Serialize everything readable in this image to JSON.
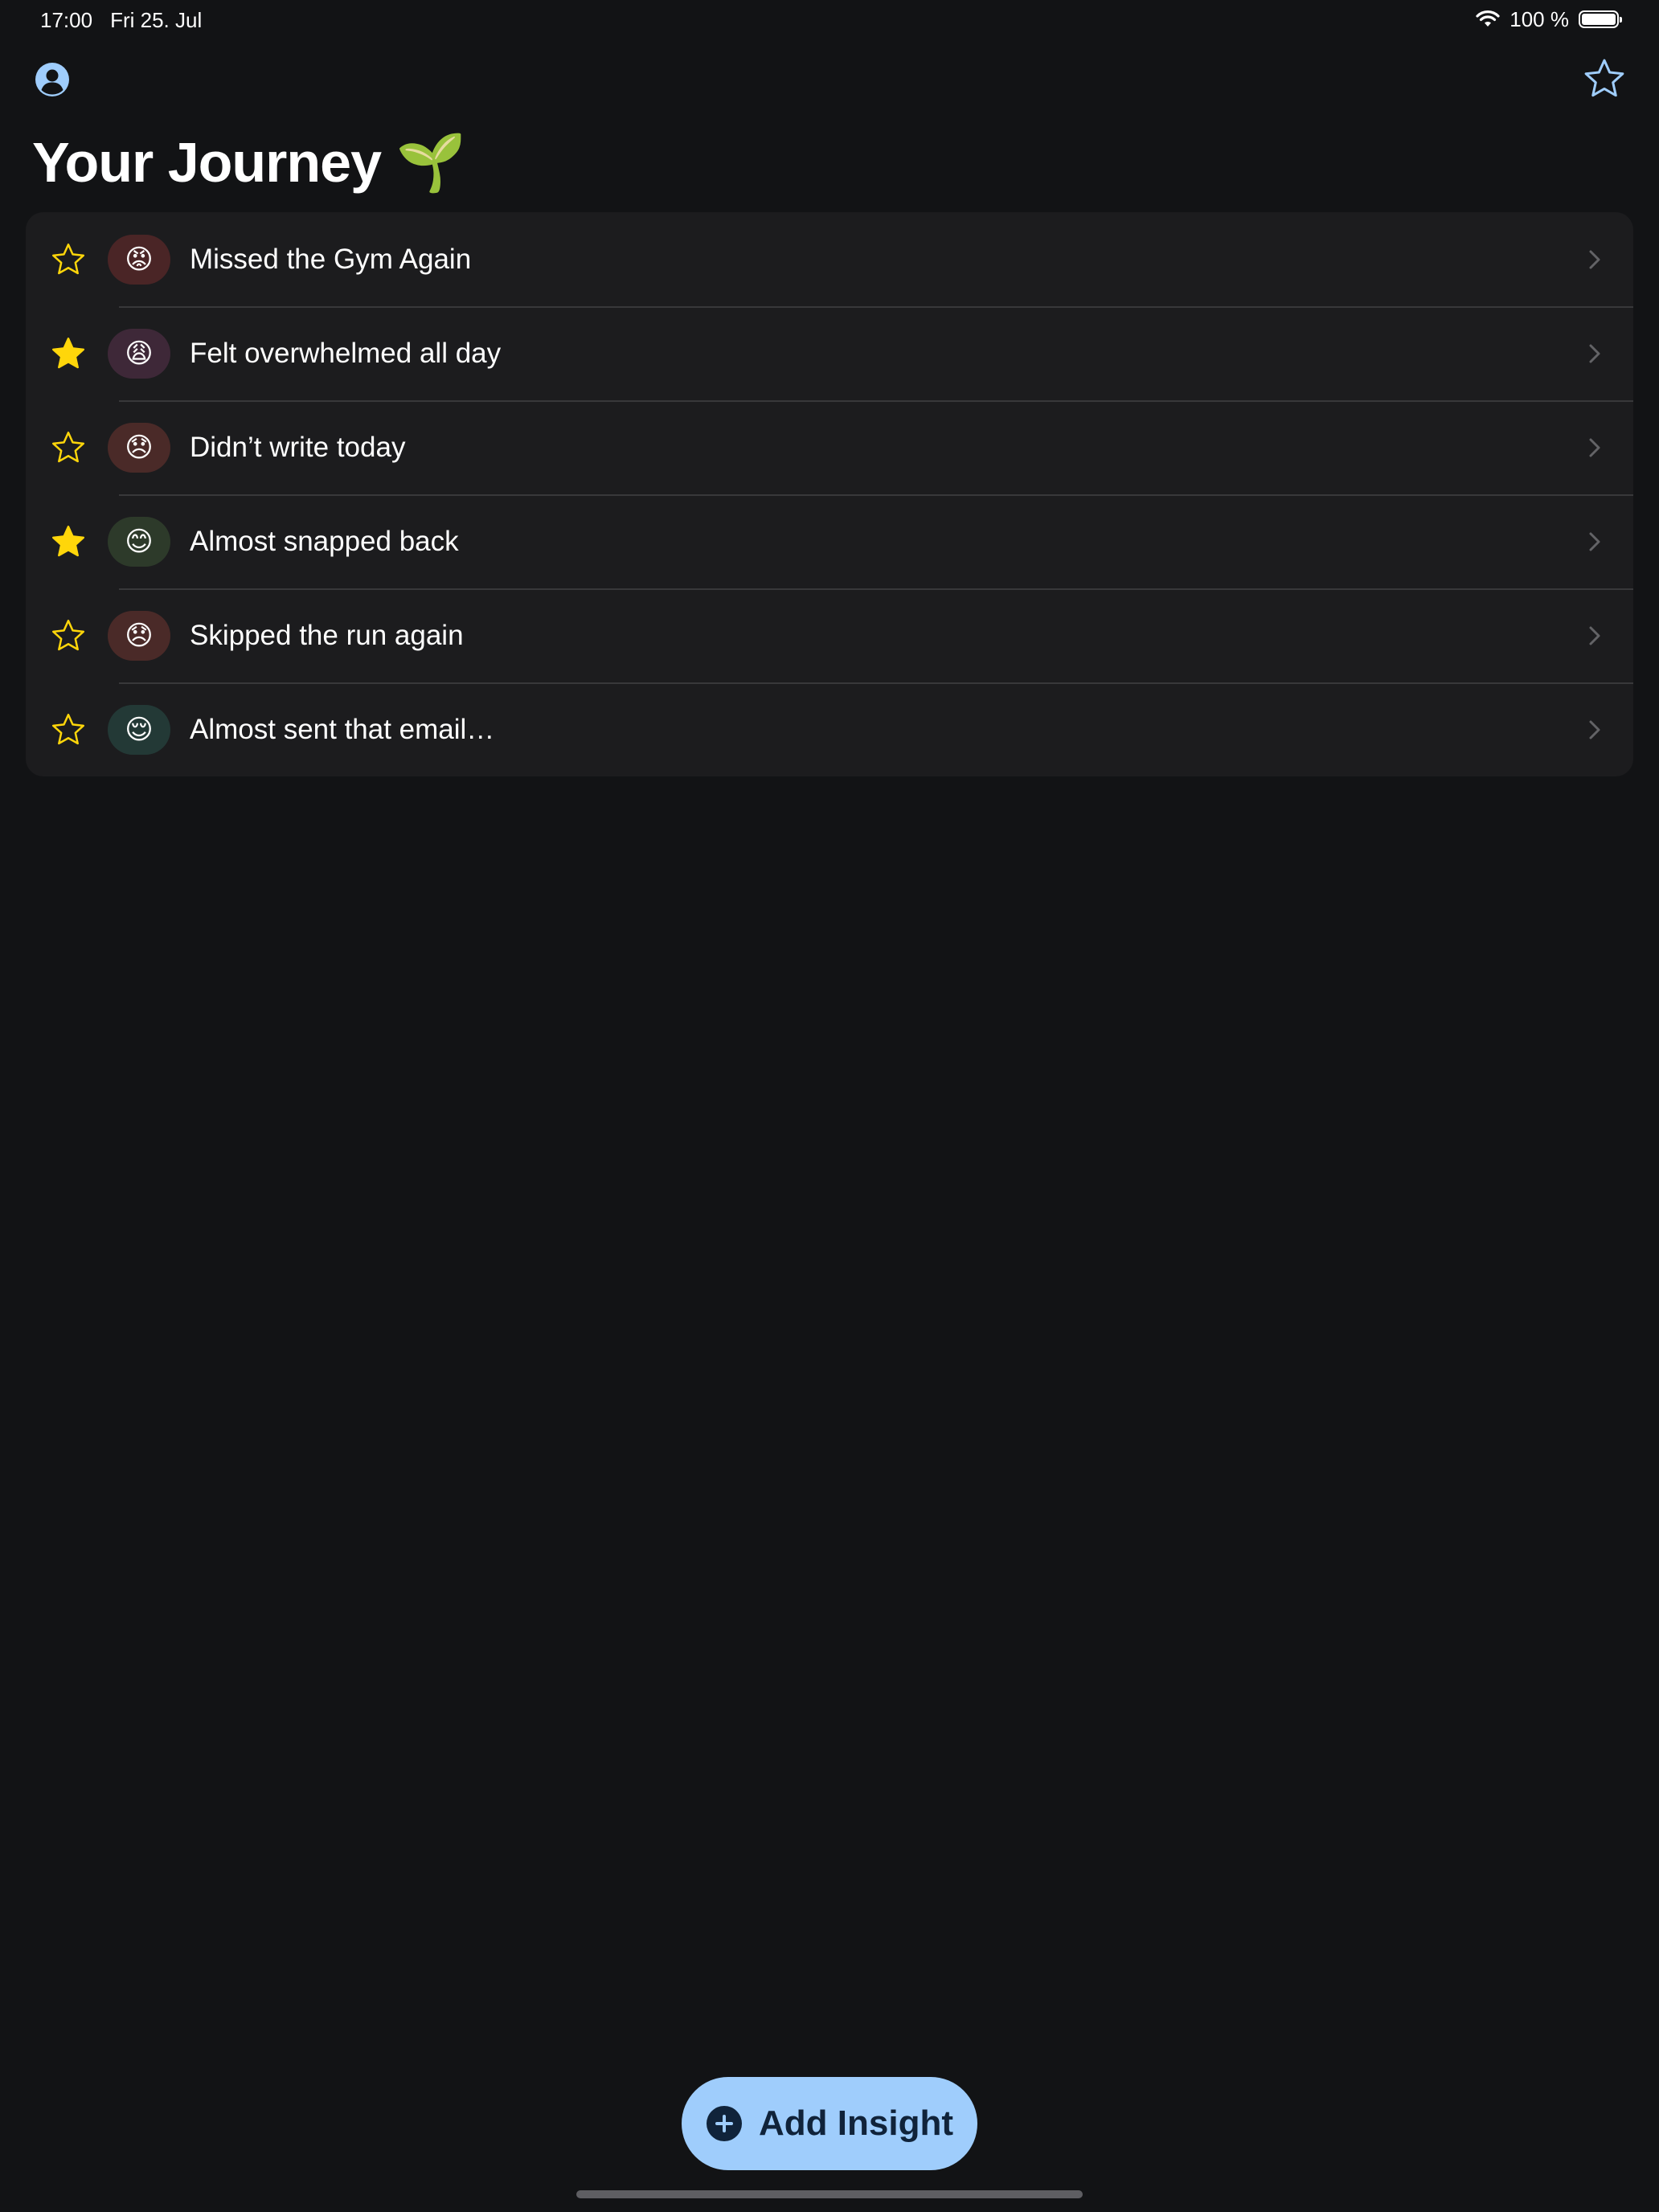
{
  "status_bar": {
    "time": "17:00",
    "date": "Fri 25. Jul",
    "battery": "100 %",
    "battery_level": 1.0
  },
  "header": {
    "title": "Your Journey 🌱",
    "profile_icon": "person-circle-icon",
    "favorites_icon": "star-outline-icon"
  },
  "colors": {
    "background": "#121315",
    "list_background": "#1c1c1e",
    "accent": "#9fcdfc",
    "star": "#ffd60a"
  },
  "insights": [
    {
      "label": "Missed the Gym Again",
      "emoji": "😡",
      "starred": false,
      "chip_color": "#4a2526"
    },
    {
      "label": "Felt overwhelmed all day",
      "emoji": "😩",
      "starred": true,
      "chip_color": "#3e2838"
    },
    {
      "label": "Didn’t write today",
      "emoji": "😞",
      "starred": false,
      "chip_color": "#4a2a28"
    },
    {
      "label": "Almost snapped back",
      "emoji": "😊",
      "starred": true,
      "chip_color": "#2d3a2a"
    },
    {
      "label": "Skipped the run again",
      "emoji": "😞",
      "starred": false,
      "chip_color": "#4a2a28"
    },
    {
      "label": "Almost sent that email…",
      "emoji": "😌",
      "starred": false,
      "chip_color": "#233936"
    }
  ],
  "add_button": {
    "label": "Add Insight",
    "icon": "plus-circle-icon"
  }
}
